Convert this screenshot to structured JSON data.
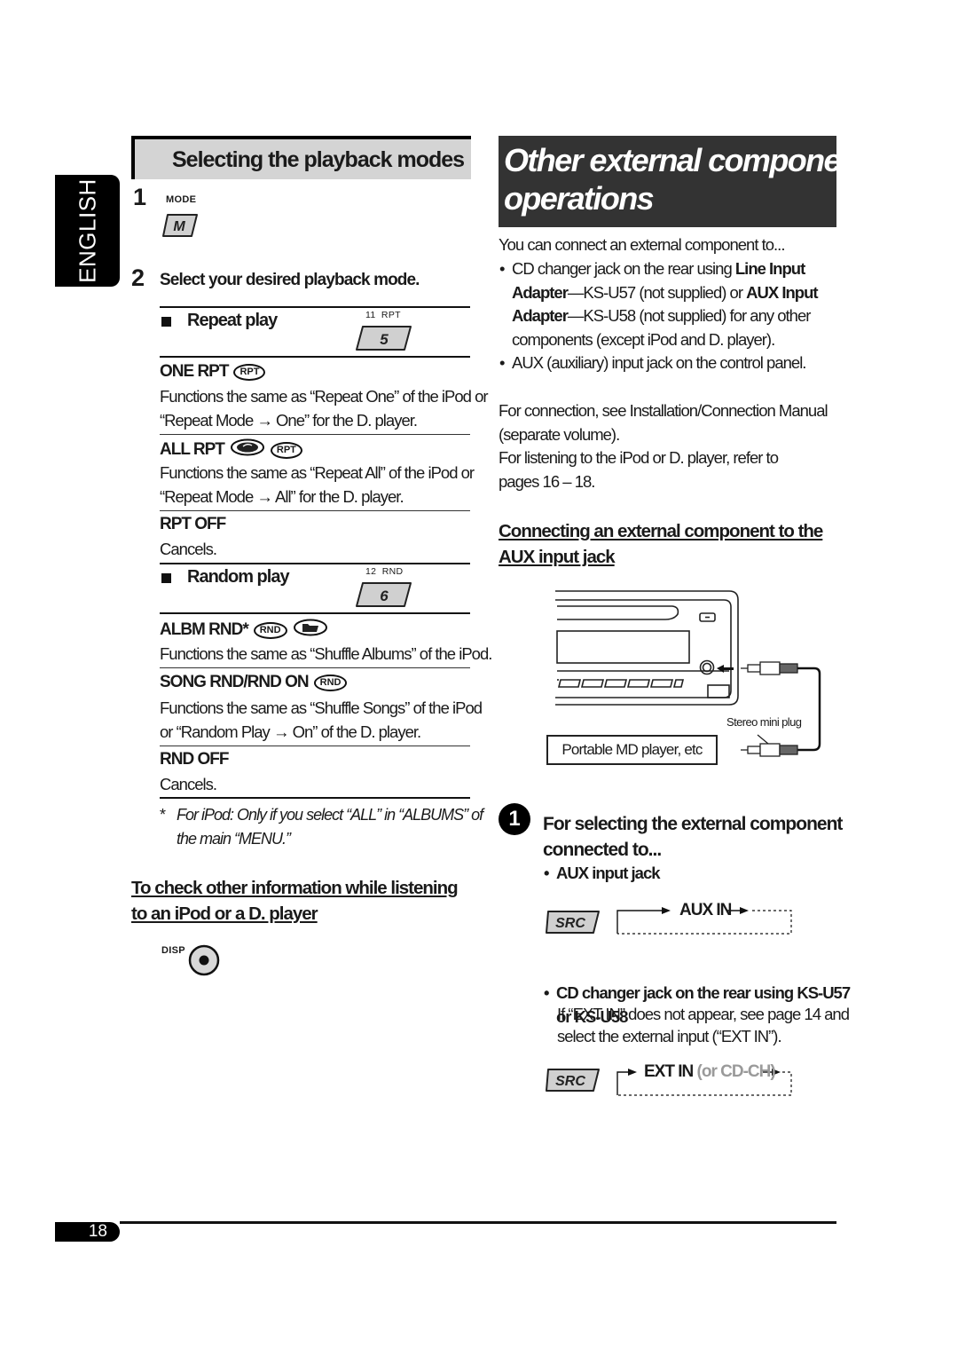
{
  "language_tab": "ENGLISH",
  "left": {
    "section_title": "Selecting the playback modes",
    "step1": {
      "number": "1",
      "button_label": "MODE",
      "button_glyph": "M"
    },
    "step2": {
      "number": "2",
      "text": "Select your desired playback mode."
    },
    "repeat": {
      "title": "Repeat play",
      "button_caption": "11  RPT",
      "button_glyph": "5",
      "modes": [
        {
          "name": "ONE RPT",
          "icons": [
            "RPT"
          ],
          "desc": [
            "Functions the same as “Repeat One” of the iPod or",
            "“Repeat Mode → One” for the D. player."
          ]
        },
        {
          "name": "ALL RPT",
          "icons": [
            "disc-icon",
            "RPT"
          ],
          "desc": [
            "Functions the same as “Repeat All” of the iPod or",
            "“Repeat Mode → All” for the D. player."
          ]
        },
        {
          "name": "RPT OFF",
          "icons": [],
          "desc": [
            "Cancels."
          ]
        }
      ]
    },
    "random": {
      "title": "Random play",
      "button_caption": "12  RND",
      "button_glyph": "6",
      "modes": [
        {
          "name": "ALBM RND*",
          "icons": [
            "RND",
            "folder-icon"
          ],
          "desc": [
            "Functions the same as “Shuffle Albums” of the iPod."
          ]
        },
        {
          "name": "SONG RND/RND ON",
          "icons": [
            "RND"
          ],
          "desc": [
            "Functions the same as “Shuffle Songs” of the iPod",
            "or “Random Play → On” of the D. player."
          ]
        },
        {
          "name": "RND OFF",
          "icons": [],
          "desc": [
            "Cancels."
          ]
        }
      ]
    },
    "footnote": {
      "mark": "*",
      "lines": [
        "For iPod: Only if you select “ALL” in “ALBUMS” of",
        "the main “MENU.”"
      ]
    },
    "info_heading": [
      "To check other information while listening",
      "to an iPod or a D. player"
    ],
    "disp_label": "DISP"
  },
  "right": {
    "title": [
      "Other external component",
      "operations"
    ],
    "intro": "You can connect an external component to...",
    "bullet1": {
      "l1_a": "CD changer jack on the rear using ",
      "l1_b": "Line Input",
      "l2_a": "Adapter",
      "l2_b": "—KS-U57 (not supplied) or ",
      "l2_c": "AUX Input",
      "l3_a": "Adapter",
      "l3_b": "—KS-U58 (not supplied) for any other",
      "l4": "components (except iPod and D. player)."
    },
    "bullet2": "AUX (auxiliary) input jack on the control panel.",
    "connection_note": [
      "For connection, see Installation/Connection Manual",
      "(separate volume).",
      "For listening to the iPod or D. player, refer to",
      "pages 16 – 18."
    ],
    "aux_heading": [
      "Connecting an external component to the",
      "AUX input jack"
    ],
    "diagram": {
      "plug_label": "Stereo mini plug",
      "device_label": "Portable MD player, etc"
    },
    "selecting": {
      "number": "1",
      "heading": [
        "For selecting the external component",
        "connected to..."
      ],
      "aux_item": "AUX input jack",
      "aux_flow": {
        "button": "SRC",
        "label": "AUX IN"
      },
      "cd_item": [
        "CD changer jack on the rear using KS-U57",
        "or KS-U58"
      ],
      "cd_note": [
        "If “EXT IN” does not appear, see page 14 and",
        "select the external input (“EXT IN”)."
      ],
      "cd_flow": {
        "button": "SRC",
        "label": "EXT IN",
        "alt_label": "(or CD-CH)"
      }
    }
  },
  "footer": {
    "page_number": "18"
  },
  "colors": {
    "title_bg": "#333333",
    "header_bg": "#d4d4d4",
    "button_fill": "#d0d0d0",
    "alt_label": "#9a9a9a"
  }
}
